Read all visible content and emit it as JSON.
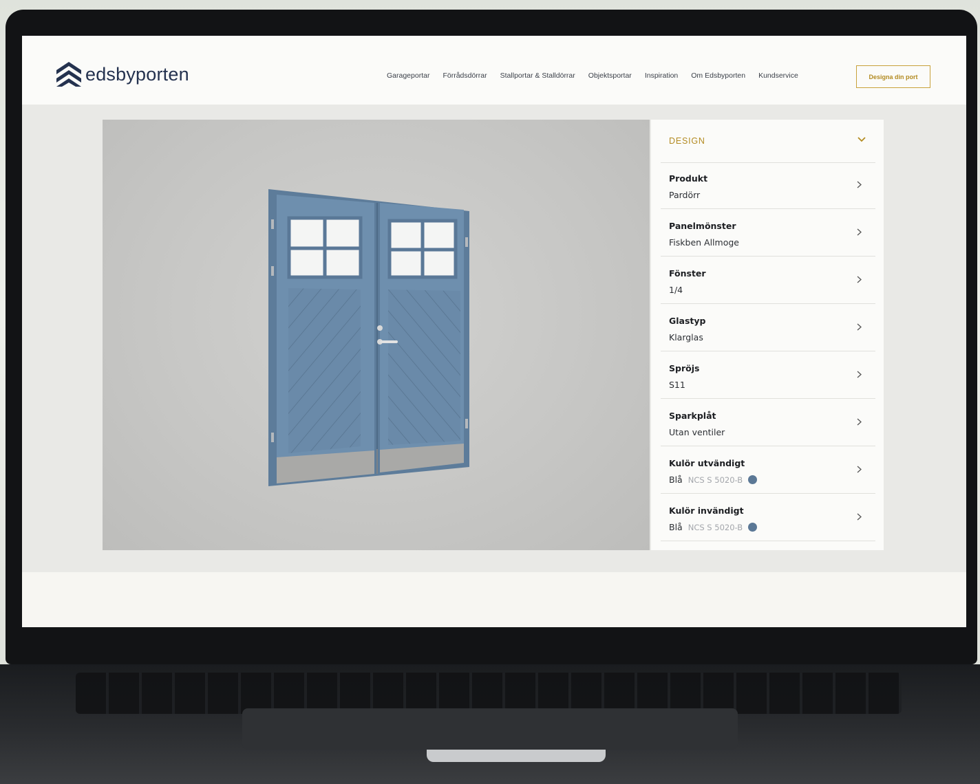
{
  "brand": {
    "name": "edsbyporten",
    "color": "#24324f"
  },
  "nav": {
    "items": [
      "Garageportar",
      "Förrådsdörrar",
      "Stallportar & Stalldörrar",
      "Objektsportar",
      "Inspiration",
      "Om Edsbyporten",
      "Kundservice"
    ],
    "cta": "Designa din port"
  },
  "panel": {
    "section_title": "DESIGN",
    "accent": "#b38b22",
    "options": [
      {
        "label": "Produkt",
        "value": "Pardörr"
      },
      {
        "label": "Panelmönster",
        "value": "Fiskben Allmoge"
      },
      {
        "label": "Fönster",
        "value": "1/4"
      },
      {
        "label": "Glastyp",
        "value": "Klarglas"
      },
      {
        "label": "Spröjs",
        "value": "S11"
      },
      {
        "label": "Sparkplåt",
        "value": "Utan ventiler"
      },
      {
        "label": "Kulör utvändigt",
        "value": "Blå",
        "code": "NCS S 5020-B",
        "swatch": "#5b7896"
      },
      {
        "label": "Kulör invändigt",
        "value": "Blå",
        "code": "NCS S 5020-B",
        "swatch": "#5b7896"
      }
    ]
  },
  "door": {
    "color": "#6e8fae",
    "kickplate": "#a9a9a7"
  }
}
